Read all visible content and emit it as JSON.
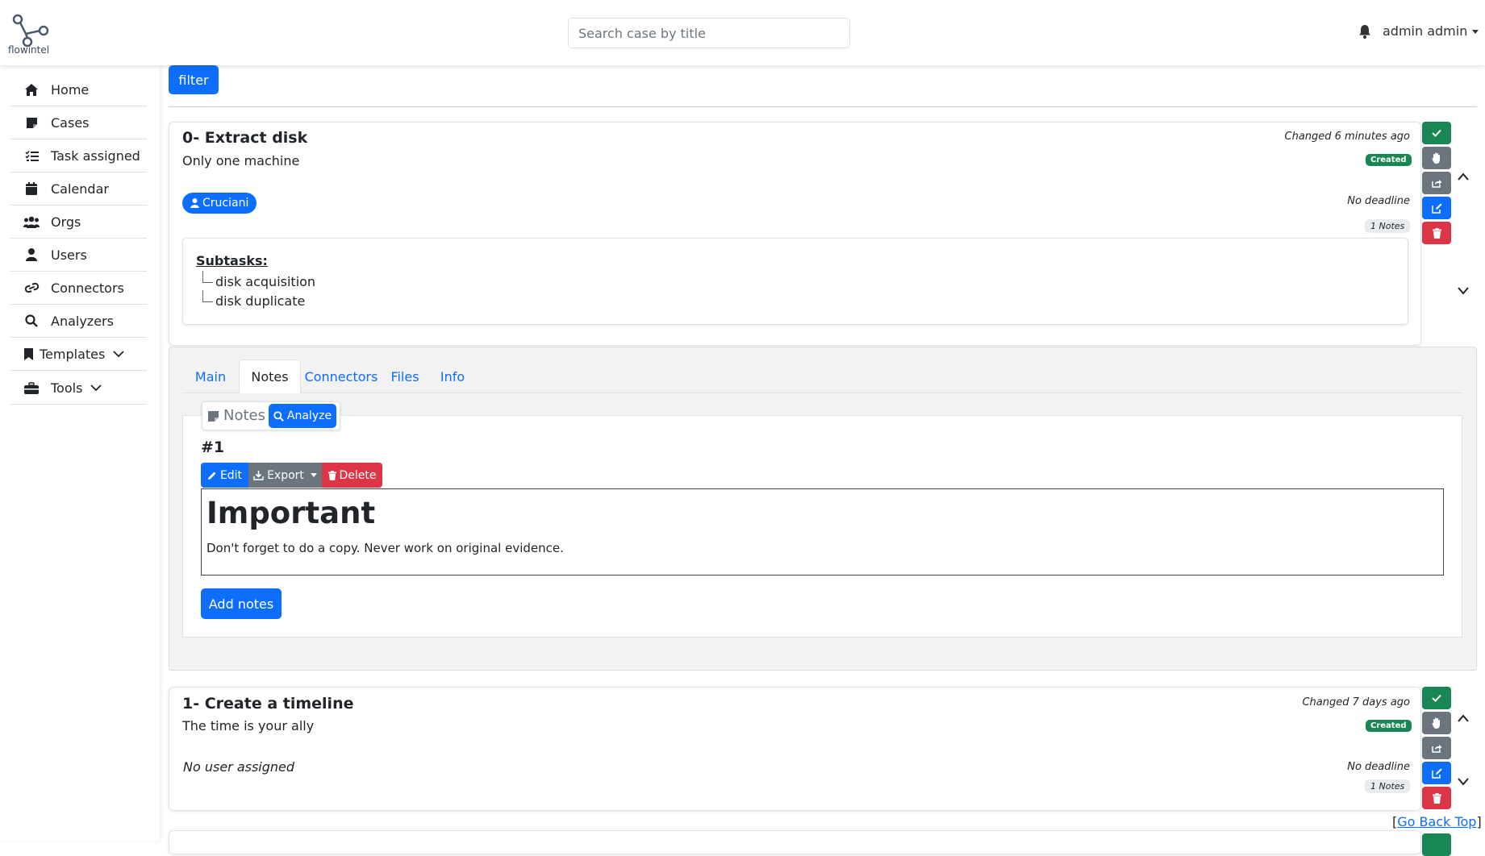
{
  "brand": {
    "name": "flowintel"
  },
  "search": {
    "placeholder": "Search case by title"
  },
  "user": {
    "name": "admin admin"
  },
  "sidebar": {
    "items": [
      {
        "label": "Home",
        "icon": "home-icon"
      },
      {
        "label": "Cases",
        "icon": "note-icon"
      },
      {
        "label": "Task assigned",
        "icon": "list-check-icon"
      },
      {
        "label": "Calendar",
        "icon": "calendar-icon"
      },
      {
        "label": "Orgs",
        "icon": "people-icon"
      },
      {
        "label": "Users",
        "icon": "user-icon"
      },
      {
        "label": "Connectors",
        "icon": "link-icon"
      },
      {
        "label": "Analyzers",
        "icon": "search-icon"
      },
      {
        "label": "Templates",
        "icon": "bookmark-icon"
      },
      {
        "label": "Tools",
        "icon": "toolbox-icon"
      }
    ]
  },
  "toolbar": {
    "filter_label": "filter"
  },
  "tasks": [
    {
      "title": "0- Extract disk",
      "description": "Only one machine",
      "changed": "Changed 6 minutes ago",
      "status": "Created",
      "deadline": "No deadline",
      "notes_count": "1 Notes",
      "assignee": "Cruciani",
      "subtasks_label": "Subtasks:",
      "subtasks": [
        "disk acquisition",
        "disk duplicate"
      ]
    },
    {
      "title": "1- Create a timeline",
      "description": "The time is your ally",
      "changed": "Changed 7 days ago",
      "status": "Created",
      "deadline": "No deadline",
      "notes_count": "1 Notes",
      "assignee_empty": "No user assigned"
    }
  ],
  "detail": {
    "tabs": [
      "Main",
      "Notes",
      "Connectors",
      "Files",
      "Info"
    ],
    "active_tab": "Notes",
    "notes_label": "Notes",
    "analyze_label": "Analyze",
    "note": {
      "number": "#1",
      "edit_label": "Edit",
      "export_label": "Export",
      "delete_label": "Delete",
      "heading": "Important",
      "body": "Don't forget to do a copy. Never work on original evidence."
    },
    "add_notes_label": "Add notes"
  },
  "footer": {
    "go_back_top": "Go Back Top",
    "bracket_open": "[",
    "bracket_close": "]"
  },
  "colors": {
    "primary": "#0d6efd",
    "success": "#198754",
    "secondary": "#6c757d",
    "danger": "#dc3545"
  }
}
